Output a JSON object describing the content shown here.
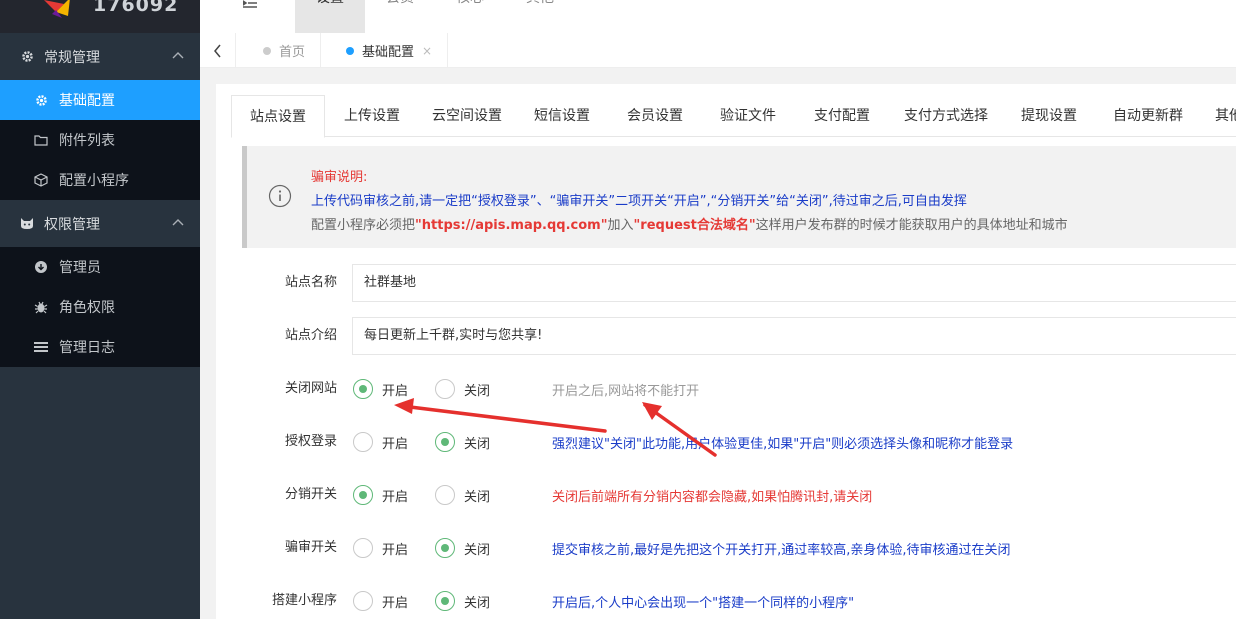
{
  "app": {
    "logo_text": "176092"
  },
  "sidebar": {
    "groups": [
      {
        "label": "常规管理",
        "icon": "gear-icon",
        "items": [
          {
            "label": "基础配置",
            "icon": "gear-icon",
            "active": true
          },
          {
            "label": "附件列表",
            "icon": "folder-icon"
          },
          {
            "label": "配置小程序",
            "icon": "cube-icon"
          }
        ]
      },
      {
        "label": "权限管理",
        "icon": "cat-icon",
        "items": [
          {
            "label": "管理员",
            "icon": "user-circle-icon"
          },
          {
            "label": "角色权限",
            "icon": "bug-icon"
          },
          {
            "label": "管理日志",
            "icon": "list-icon"
          }
        ]
      }
    ]
  },
  "topbar": {
    "tabs": [
      "设置",
      "会员",
      "核心",
      "其他"
    ],
    "active_tab": "设置"
  },
  "pagetabs": {
    "items": [
      {
        "label": "首页"
      },
      {
        "label": "基础配置",
        "active": true,
        "close": "×"
      }
    ]
  },
  "settings_tabs": [
    "站点设置",
    "上传设置",
    "云空间设置",
    "短信设置",
    "会员设置",
    "验证文件",
    "支付配置",
    "支付方式选择",
    "提现设置",
    "自动更新群",
    "其他"
  ],
  "notice": {
    "title": "骗审说明:",
    "line2": "上传代码审核之前,请一定把“授权登录”、“骗审开关”二项开关“开启”,“分销开关”给“关闭”,待过审之后,可自由发挥",
    "line3_a": "配置小程序必须把",
    "line3_url": "\"https://apis.map.qq.com\"",
    "line3_b": "加入",
    "line3_domain": "\"request合法域名\"",
    "line3_c": "这样用户发布群的时候才能获取用户的具体地址和城市"
  },
  "form": {
    "site_name_label": "站点名称",
    "site_name_value": "社群基地",
    "site_intro_label": "站点介绍",
    "site_intro_value": "每日更新上千群,实时与您共享!",
    "on_label": "开启",
    "off_label": "关闭",
    "switches": [
      {
        "label": "关闭网站",
        "value": "开启",
        "hint": "开启之后,网站将不能打开",
        "hint_color": "gray"
      },
      {
        "label": "授权登录",
        "value": "关闭",
        "hint": "强烈建议\"关闭\"此功能,用户体验更佳,如果\"开启\"则必须选择头像和昵称才能登录",
        "hint_color": "blue"
      },
      {
        "label": "分销开关",
        "value": "开启",
        "hint": "关闭后前端所有分销内容都会隐藏,如果怕腾讯封,请关闭",
        "hint_color": "red"
      },
      {
        "label": "骗审开关",
        "value": "关闭",
        "hint": "提交审核之前,最好是先把这个开关打开,通过率较高,亲身体验,待审核通过在关闭",
        "hint_color": "blue"
      },
      {
        "label": "搭建小程序",
        "value": "关闭",
        "hint": "开启后,个人中心会出现一个\"搭建一个同样的小程序\"",
        "hint_color": "blue"
      }
    ]
  },
  "colors": {
    "sidebar_bg": "#28333e",
    "active_blue": "#1e9fff",
    "radio_green": "#5fb878",
    "annotation_red": "#e5302d"
  }
}
